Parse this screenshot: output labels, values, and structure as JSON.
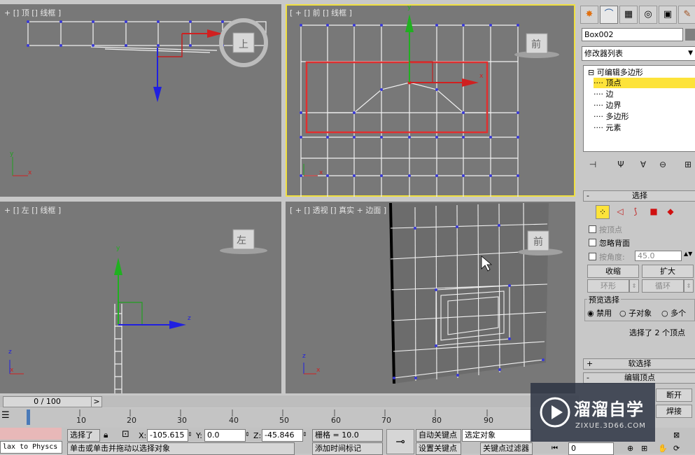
{
  "viewports": {
    "top": {
      "label": "+ [] 顶 [] 线框 ]",
      "cube": "上"
    },
    "front": {
      "label": "[ + [] 前 [] 线框 ]",
      "cube": "前"
    },
    "left": {
      "label": "+ [] 左 [] 线框 ]",
      "cube": "左"
    },
    "perspective": {
      "label": "[ + [] 透视 [] 真实 + 边面 ]",
      "cube": "前"
    }
  },
  "axes": {
    "x": "x",
    "y": "y",
    "z": "z"
  },
  "command_panel": {
    "tab_icons": [
      "sun-icon",
      "curve-icon",
      "hierarchy-icon",
      "motion-icon",
      "display-icon",
      "utilities-icon"
    ],
    "object_name": "Box002",
    "modifier_list": "修改器列表",
    "stack": {
      "root": "可编辑多边形",
      "items": [
        "顶点",
        "边",
        "边界",
        "多边形",
        "元素"
      ],
      "selected_index": 0
    },
    "selection": {
      "title": "选择",
      "by_vertex": "按顶点",
      "ignore_backfacing": "忽略背面",
      "by_angle": "按角度:",
      "angle_value": "45.0",
      "shrink": "收缩",
      "grow": "扩大",
      "ring": "环形",
      "loop": "循环",
      "preview_title": "预览选择",
      "preview_options": [
        "禁用",
        "子对象",
        "多个"
      ],
      "status": "选择了 2 个顶点"
    },
    "soft_selection": "软选择",
    "edit_vertices": "编辑顶点",
    "break_label": "断开",
    "weld_label": "焊接"
  },
  "timeline": {
    "frame": "0 / 100",
    "arrow": ">",
    "ticks": [
      "10",
      "20",
      "30",
      "40",
      "50",
      "60",
      "70",
      "80",
      "90"
    ]
  },
  "status_bar": {
    "maxscript": "lax to Physcs",
    "selected": "选择了",
    "x_label": "X:",
    "x_value": "-105.615",
    "y_label": "Y:",
    "y_value": "0.0",
    "z_label": "Z:",
    "z_value": "-45.846",
    "grid": "栅格 = 10.0",
    "auto_key": "自动关键点",
    "set_key": "设置关键点",
    "selected_object": "选定对象",
    "key_filters": "关键点过滤器",
    "prompt": "单击或单击并拖动以选择对象",
    "add_time_tag": "添加时间标记",
    "frame_field": "0"
  },
  "watermark": {
    "brand": "溜溜自学",
    "url": "ZIXUE.3D66.COM"
  }
}
